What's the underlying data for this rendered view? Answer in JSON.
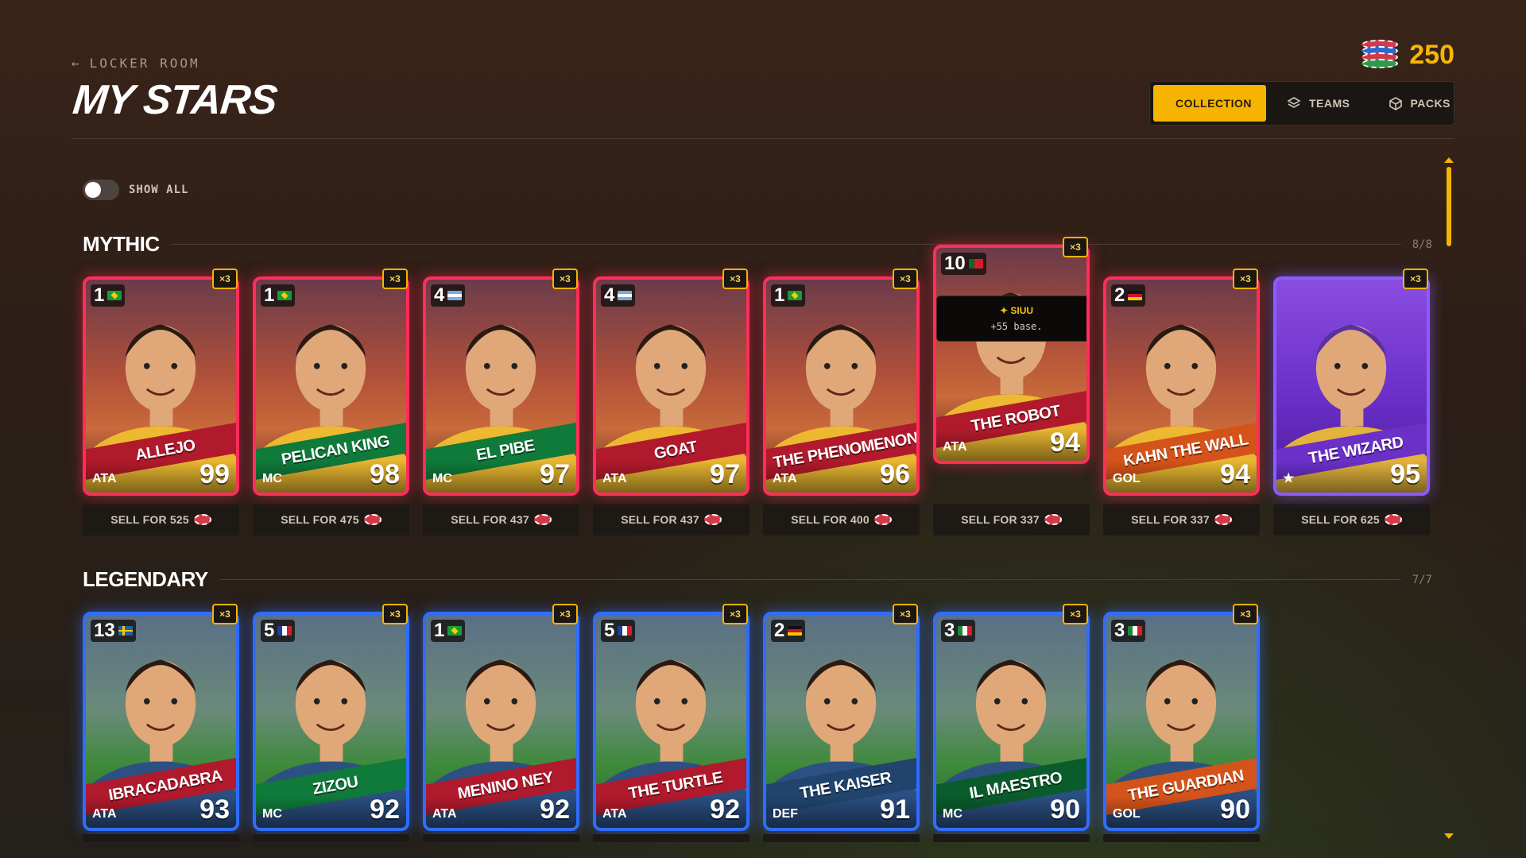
{
  "header": {
    "back_label": "LOCKER ROOM",
    "title": "MY STARS",
    "coins": "250"
  },
  "tabs": [
    {
      "label": "COLLECTION",
      "icon": "library-icon",
      "active": true
    },
    {
      "label": "TEAMS",
      "icon": "layers-icon",
      "active": false
    },
    {
      "label": "PACKS",
      "icon": "box-icon",
      "active": false
    }
  ],
  "filter": {
    "show_all_label": "SHOW ALL",
    "show_all_on": false
  },
  "sections": [
    {
      "name": "MYTHIC",
      "count": "8/8",
      "cards": [
        {
          "num": "1",
          "flag": "br",
          "name": "ALLEJO",
          "pos": "ATA",
          "ovr": "99",
          "mult": "×3",
          "sell": "SELL FOR 525",
          "banner": "red",
          "style": "mythic"
        },
        {
          "num": "1",
          "flag": "br",
          "name": "PELICAN KING",
          "pos": "MC",
          "ovr": "98",
          "mult": "×3",
          "sell": "SELL FOR 475",
          "banner": "green",
          "style": "mythic"
        },
        {
          "num": "4",
          "flag": "ar",
          "name": "EL PIBE",
          "pos": "MC",
          "ovr": "97",
          "mult": "×3",
          "sell": "SELL FOR 437",
          "banner": "green",
          "style": "mythic"
        },
        {
          "num": "4",
          "flag": "ar",
          "name": "GOAT",
          "pos": "ATA",
          "ovr": "97",
          "mult": "×3",
          "sell": "SELL FOR 437",
          "banner": "red",
          "style": "mythic"
        },
        {
          "num": "1",
          "flag": "br",
          "name": "THE PHENOMENON",
          "pos": "ATA",
          "ovr": "96",
          "mult": "×3",
          "sell": "SELL FOR 400",
          "banner": "red",
          "style": "mythic"
        },
        {
          "num": "10",
          "flag": "pt",
          "name": "THE ROBOT",
          "pos": "ATA",
          "ovr": "94",
          "mult": "×3",
          "sell": "SELL FOR 337",
          "banner": "red",
          "style": "mythic",
          "raised": true,
          "tooltip": {
            "title": "✦ SIUU",
            "desc": "+55 base."
          }
        },
        {
          "num": "2",
          "flag": "de",
          "name": "KAHN THE WALL",
          "pos": "GOL",
          "ovr": "94",
          "mult": "×3",
          "sell": "SELL FOR 337",
          "banner": "orange",
          "style": "mythic"
        },
        {
          "num": "",
          "flag": "",
          "name": "THE WIZARD",
          "pos": "★",
          "ovr": "95",
          "mult": "×3",
          "sell": "SELL FOR 625",
          "banner": "purple",
          "style": "wizard"
        }
      ]
    },
    {
      "name": "LEGENDARY",
      "count": "7/7",
      "cards": [
        {
          "num": "13",
          "flag": "se",
          "name": "IBRACADABRA",
          "pos": "ATA",
          "ovr": "93",
          "mult": "×3",
          "banner": "red",
          "style": "legendary"
        },
        {
          "num": "5",
          "flag": "fr",
          "name": "ZIZOU",
          "pos": "MC",
          "ovr": "92",
          "mult": "×3",
          "banner": "green",
          "style": "legendary"
        },
        {
          "num": "1",
          "flag": "br",
          "name": "MENINO NEY",
          "pos": "ATA",
          "ovr": "92",
          "mult": "×3",
          "banner": "red",
          "style": "legendary"
        },
        {
          "num": "5",
          "flag": "fr",
          "name": "THE TURTLE",
          "pos": "ATA",
          "ovr": "92",
          "mult": "×3",
          "banner": "red",
          "style": "legendary"
        },
        {
          "num": "2",
          "flag": "de",
          "name": "THE KAISER",
          "pos": "DEF",
          "ovr": "91",
          "mult": "×3",
          "banner": "slate",
          "style": "legendary"
        },
        {
          "num": "3",
          "flag": "it",
          "name": "IL MAESTRO",
          "pos": "MC",
          "ovr": "90",
          "mult": "×3",
          "banner": "deepgreen",
          "style": "legendary"
        },
        {
          "num": "3",
          "flag": "it",
          "name": "THE GUARDIAN",
          "pos": "GOL",
          "ovr": "90",
          "mult": "×3",
          "banner": "orange",
          "style": "legendary"
        }
      ]
    }
  ],
  "colors": {
    "accent": "#f5b400",
    "mythic_border": "#ff2e5a",
    "legendary_border": "#2f6dff",
    "wizard_border": "#8a5cff"
  }
}
